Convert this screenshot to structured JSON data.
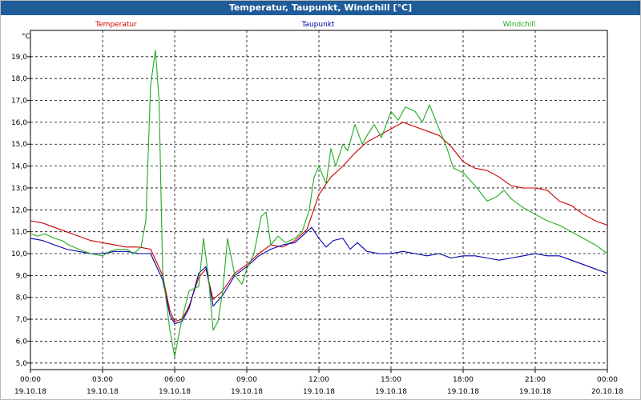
{
  "window": {
    "title": "Temperatur, Taupunkt, Windchill [°C]"
  },
  "chart_data": {
    "type": "line",
    "unit_label": "°C",
    "ylim": [
      4.7,
      20.2
    ],
    "xlim": [
      0,
      24
    ],
    "grid": true,
    "legend_placement": "top",
    "y_ticks": [
      "5,0",
      "6,0",
      "7,0",
      "8,0",
      "9,0",
      "10,0",
      "11,0",
      "12,0",
      "13,0",
      "14,0",
      "15,0",
      "16,0",
      "17,0",
      "18,0",
      "19,0"
    ],
    "x_ticks": [
      {
        "time": "00:00",
        "date": "19.10.18"
      },
      {
        "time": "03:00",
        "date": "19.10.18"
      },
      {
        "time": "06:00",
        "date": "19.10.18"
      },
      {
        "time": "09:00",
        "date": "19.10.18"
      },
      {
        "time": "12:00",
        "date": "19.10.18"
      },
      {
        "time": "15:00",
        "date": "19.10.18"
      },
      {
        "time": "18:00",
        "date": "19.10.18"
      },
      {
        "time": "21:00",
        "date": "19.10.18"
      },
      {
        "time": "00:00",
        "date": "20.10.18"
      }
    ],
    "series": [
      {
        "name": "Temperatur",
        "color": "#cc0000",
        "points": [
          [
            0,
            11.5
          ],
          [
            0.5,
            11.4
          ],
          [
            1,
            11.2
          ],
          [
            1.5,
            11.0
          ],
          [
            2,
            10.8
          ],
          [
            2.5,
            10.6
          ],
          [
            3,
            10.5
          ],
          [
            3.5,
            10.4
          ],
          [
            4,
            10.3
          ],
          [
            4.5,
            10.3
          ],
          [
            5,
            10.2
          ],
          [
            5.5,
            9.0
          ],
          [
            5.8,
            7.4
          ],
          [
            6.0,
            6.9
          ],
          [
            6.3,
            7.0
          ],
          [
            6.6,
            7.6
          ],
          [
            7.0,
            8.9
          ],
          [
            7.3,
            9.3
          ],
          [
            7.6,
            7.9
          ],
          [
            8.0,
            8.3
          ],
          [
            8.5,
            9.1
          ],
          [
            9,
            9.5
          ],
          [
            9.5,
            10.0
          ],
          [
            10,
            10.4
          ],
          [
            10.5,
            10.3
          ],
          [
            11,
            10.6
          ],
          [
            11.5,
            11.1
          ],
          [
            12,
            12.7
          ],
          [
            12.5,
            13.5
          ],
          [
            13,
            14.0
          ],
          [
            13.5,
            14.6
          ],
          [
            14,
            15.1
          ],
          [
            14.5,
            15.4
          ],
          [
            15,
            15.7
          ],
          [
            15.5,
            16.0
          ],
          [
            16,
            15.8
          ],
          [
            16.5,
            15.6
          ],
          [
            17,
            15.4
          ],
          [
            17.5,
            14.9
          ],
          [
            18,
            14.2
          ],
          [
            18.5,
            13.9
          ],
          [
            19,
            13.8
          ],
          [
            19.5,
            13.5
          ],
          [
            20,
            13.1
          ],
          [
            20.5,
            13.0
          ],
          [
            21,
            13.0
          ],
          [
            21.5,
            12.9
          ],
          [
            22,
            12.4
          ],
          [
            22.5,
            12.2
          ],
          [
            23,
            11.8
          ],
          [
            23.5,
            11.5
          ],
          [
            24,
            11.3
          ]
        ]
      },
      {
        "name": "Taupunkt",
        "color": "#0000aa",
        "points": [
          [
            0,
            10.7
          ],
          [
            0.5,
            10.6
          ],
          [
            1,
            10.4
          ],
          [
            1.5,
            10.2
          ],
          [
            2,
            10.1
          ],
          [
            2.5,
            10.0
          ],
          [
            3,
            10.0
          ],
          [
            3.5,
            10.1
          ],
          [
            4,
            10.1
          ],
          [
            4.5,
            10.0
          ],
          [
            5,
            10.0
          ],
          [
            5.5,
            8.8
          ],
          [
            5.8,
            7.2
          ],
          [
            6.0,
            6.8
          ],
          [
            6.3,
            6.9
          ],
          [
            6.6,
            7.5
          ],
          [
            7.0,
            9.1
          ],
          [
            7.3,
            9.4
          ],
          [
            7.6,
            7.6
          ],
          [
            8.0,
            8.1
          ],
          [
            8.5,
            9.0
          ],
          [
            9,
            9.4
          ],
          [
            9.5,
            9.9
          ],
          [
            10,
            10.2
          ],
          [
            10.5,
            10.4
          ],
          [
            11,
            10.5
          ],
          [
            11.5,
            11.0
          ],
          [
            11.7,
            11.2
          ],
          [
            12,
            10.7
          ],
          [
            12.3,
            10.3
          ],
          [
            12.6,
            10.6
          ],
          [
            13,
            10.7
          ],
          [
            13.3,
            10.2
          ],
          [
            13.6,
            10.5
          ],
          [
            14,
            10.1
          ],
          [
            14.5,
            10.0
          ],
          [
            15,
            10.0
          ],
          [
            15.5,
            10.1
          ],
          [
            16,
            10.0
          ],
          [
            16.5,
            9.9
          ],
          [
            17,
            10.0
          ],
          [
            17.5,
            9.8
          ],
          [
            18,
            9.9
          ],
          [
            18.5,
            9.9
          ],
          [
            19,
            9.8
          ],
          [
            19.5,
            9.7
          ],
          [
            20,
            9.8
          ],
          [
            20.5,
            9.9
          ],
          [
            21,
            10.0
          ],
          [
            21.5,
            9.9
          ],
          [
            22,
            9.9
          ],
          [
            22.5,
            9.7
          ],
          [
            23,
            9.5
          ],
          [
            23.5,
            9.3
          ],
          [
            24,
            9.1
          ]
        ]
      },
      {
        "name": "Windchill",
        "color": "#22aa22",
        "points": [
          [
            0,
            10.9
          ],
          [
            0.3,
            10.8
          ],
          [
            0.6,
            10.9
          ],
          [
            1,
            10.7
          ],
          [
            1.3,
            10.6
          ],
          [
            1.6,
            10.4
          ],
          [
            2,
            10.2
          ],
          [
            2.5,
            10.0
          ],
          [
            3,
            9.9
          ],
          [
            3.3,
            10.1
          ],
          [
            3.6,
            10.2
          ],
          [
            4,
            10.2
          ],
          [
            4.3,
            10.0
          ],
          [
            4.6,
            10.3
          ],
          [
            4.8,
            11.5
          ],
          [
            5.0,
            17.7
          ],
          [
            5.2,
            19.3
          ],
          [
            5.35,
            17.0
          ],
          [
            5.5,
            9.2
          ],
          [
            5.8,
            6.5
          ],
          [
            6.0,
            5.3
          ],
          [
            6.3,
            7.0
          ],
          [
            6.6,
            8.3
          ],
          [
            7.0,
            8.5
          ],
          [
            7.2,
            10.7
          ],
          [
            7.4,
            9.0
          ],
          [
            7.6,
            6.5
          ],
          [
            7.8,
            6.9
          ],
          [
            8.0,
            8.3
          ],
          [
            8.2,
            10.7
          ],
          [
            8.5,
            9.0
          ],
          [
            8.8,
            8.6
          ],
          [
            9,
            9.3
          ],
          [
            9.3,
            10.0
          ],
          [
            9.6,
            11.7
          ],
          [
            9.8,
            11.9
          ],
          [
            10,
            10.4
          ],
          [
            10.3,
            10.8
          ],
          [
            10.6,
            10.5
          ],
          [
            11,
            10.7
          ],
          [
            11.3,
            11.0
          ],
          [
            11.6,
            12.0
          ],
          [
            11.8,
            13.5
          ],
          [
            12,
            14.0
          ],
          [
            12.3,
            13.2
          ],
          [
            12.5,
            14.8
          ],
          [
            12.7,
            14.0
          ],
          [
            13,
            15.0
          ],
          [
            13.2,
            14.7
          ],
          [
            13.5,
            15.9
          ],
          [
            13.8,
            15.0
          ],
          [
            14,
            15.4
          ],
          [
            14.3,
            15.9
          ],
          [
            14.6,
            15.3
          ],
          [
            15,
            16.5
          ],
          [
            15.3,
            16.1
          ],
          [
            15.6,
            16.7
          ],
          [
            16,
            16.5
          ],
          [
            16.3,
            16.0
          ],
          [
            16.6,
            16.8
          ],
          [
            17,
            15.7
          ],
          [
            17.3,
            14.9
          ],
          [
            17.6,
            13.9
          ],
          [
            18,
            13.7
          ],
          [
            18.5,
            13.1
          ],
          [
            19,
            12.4
          ],
          [
            19.4,
            12.6
          ],
          [
            19.7,
            12.9
          ],
          [
            20,
            12.5
          ],
          [
            20.5,
            12.1
          ],
          [
            21,
            11.8
          ],
          [
            21.5,
            11.5
          ],
          [
            22,
            11.3
          ],
          [
            22.5,
            11.0
          ],
          [
            23,
            10.7
          ],
          [
            23.5,
            10.4
          ],
          [
            24,
            10.0
          ]
        ]
      }
    ]
  }
}
